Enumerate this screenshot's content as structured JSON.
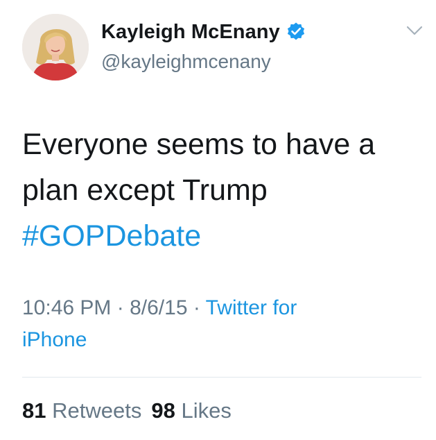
{
  "author": {
    "display_name": "Kayleigh McEnany",
    "handle": "@kayleighmcenany",
    "verified": true
  },
  "tweet": {
    "text_line1": "Everyone seems to have a",
    "text_line2": "plan except Trump",
    "hashtag": "#GOPDebate"
  },
  "meta": {
    "time": "10:46 PM",
    "separator1": " · ",
    "date": "8/6/15",
    "separator2": " · ",
    "source_line1": "Twitter for",
    "source_line2": "iPhone"
  },
  "stats": {
    "retweets_count": "81",
    "retweets_label": "Retweets",
    "likes_count": "98",
    "likes_label": "Likes"
  },
  "colors": {
    "link": "#1b95e0",
    "secondary_text": "#657786",
    "primary_text": "#14171a",
    "divider": "#e1e8ed"
  },
  "icons": {
    "verified": "verified-badge-icon",
    "menu": "chevron-down-icon"
  }
}
